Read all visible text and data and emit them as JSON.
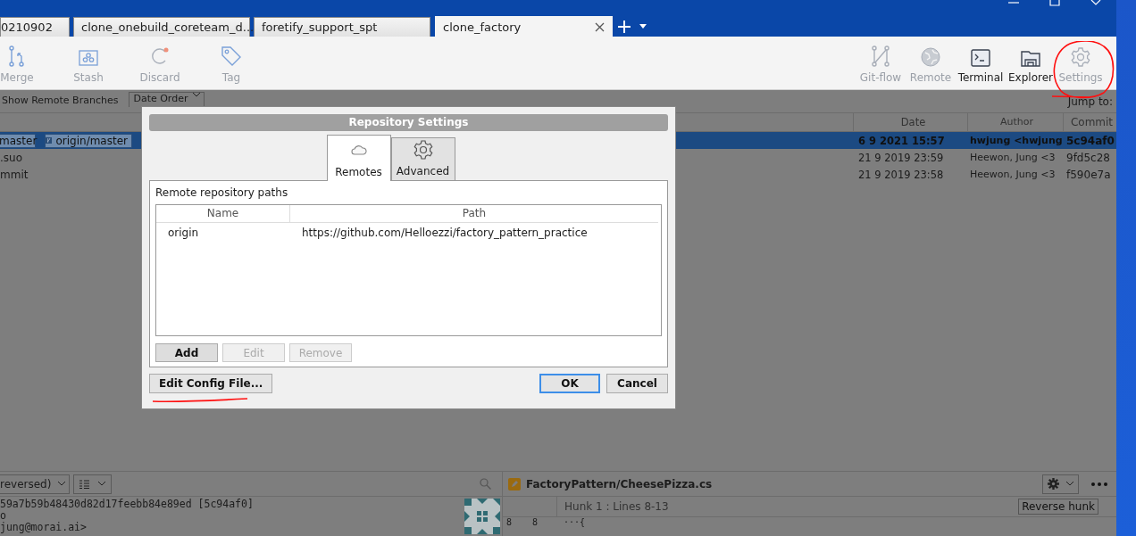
{
  "tabs": [
    {
      "label": "0210902",
      "selected": false
    },
    {
      "label": "clone_onebuild_coreteam_d...",
      "selected": false
    },
    {
      "label": "foretify_support_spt",
      "selected": false
    },
    {
      "label": "clone_factory",
      "selected": true
    }
  ],
  "toolbar_left": [
    {
      "label": "Merge",
      "disabled": true
    },
    {
      "label": "Stash",
      "disabled": true
    },
    {
      "label": "Discard",
      "disabled": true
    },
    {
      "label": "Tag",
      "disabled": true
    }
  ],
  "toolbar_right": [
    {
      "label": "Git-flow",
      "disabled": true
    },
    {
      "label": "Remote",
      "disabled": true
    },
    {
      "label": "Terminal",
      "disabled": false
    },
    {
      "label": "Explorer",
      "disabled": false
    },
    {
      "label": "Settings",
      "disabled": true
    }
  ],
  "filter_bar": {
    "show_remote_branches": "Show Remote Branches",
    "order": "Date Order",
    "jump_to": "Jump to:"
  },
  "commit_table": {
    "columns": [
      "Date",
      "Author",
      "Commit"
    ],
    "rows": [
      {
        "branches": [
          {
            "label": "master",
            "kind": "local"
          },
          {
            "label": "origin/master",
            "kind": "remote"
          }
        ],
        "description": "",
        "date": "6 9 2021 15:57",
        "author": "hwjung <hwjung",
        "commit": "5c94af0",
        "selected": true
      },
      {
        "branches": [],
        "description": ".suo",
        "date": "21 9 2019 23:59",
        "author": "Heewon, Jung <3",
        "commit": "9fd5c28",
        "selected": false
      },
      {
        "branches": [],
        "description": "mmit",
        "date": "21 9 2019 23:58",
        "author": "Heewon, Jung <3",
        "commit": "f590e7a",
        "selected": false
      }
    ]
  },
  "details": {
    "order": "reversed)",
    "lines": [
      "59a7b59b48430d82d17feebb84e89ed [5c94af0]",
      "o",
      "jung@morai.ai>"
    ]
  },
  "diff": {
    "file": "FactoryPattern/CheesePizza.cs",
    "hunk": "Hunk 1 : Lines 8-13",
    "reverse_button": "Reverse hunk",
    "lines": [
      {
        "old": "8",
        "new": "8",
        "code": "···{"
      }
    ]
  },
  "dialog": {
    "title": "Repository Settings",
    "tabs": [
      {
        "label": "Remotes",
        "selected": true
      },
      {
        "label": "Advanced",
        "selected": false
      }
    ],
    "section_label": "Remote repository paths",
    "columns": [
      "Name",
      "Path"
    ],
    "remotes": [
      {
        "name": "origin",
        "path": "https://github.com/Helloezzi/factory_pattern_practice"
      }
    ],
    "list_buttons": [
      {
        "label": "Add",
        "disabled": false
      },
      {
        "label": "Edit",
        "disabled": true
      },
      {
        "label": "Remove",
        "disabled": true
      }
    ],
    "edit_config": "Edit Config File...",
    "ok": "OK",
    "cancel": "Cancel"
  }
}
